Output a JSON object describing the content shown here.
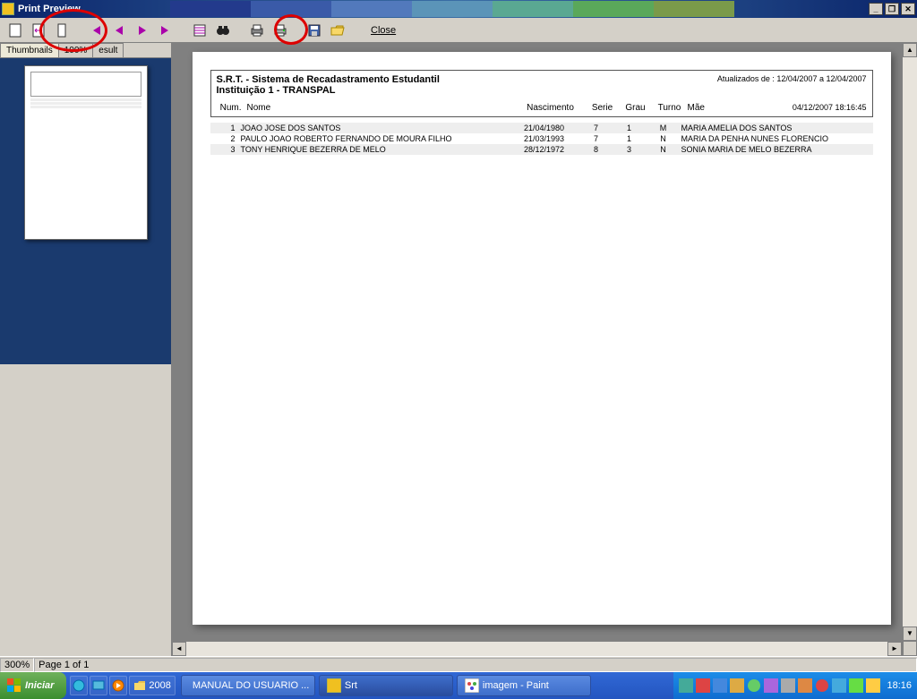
{
  "window": {
    "title": "Print Preview",
    "minimize": "_",
    "maximize": "❐",
    "close": "✕"
  },
  "toolbar": {
    "close_label": "Close"
  },
  "tabs": {
    "thumbnails": "Thumbnails",
    "search": "100%",
    "result": "esult"
  },
  "report": {
    "title": "S.R.T. - Sistema de Recadastramento Estudantil",
    "subtitle": "Instituição  1 - TRANSPAL",
    "updated_label": "Atualizados de : 12/04/2007 a 12/04/2007",
    "datetime": "04/12/2007 18:16:45",
    "headers": {
      "num": "Num.",
      "nome": "Nome",
      "nasc": "Nascimento",
      "serie": "Serie",
      "grau": "Grau",
      "turno": "Turno",
      "mae": "Mãe"
    },
    "rows": [
      {
        "num": "1",
        "nome": "JOAO JOSE DOS SANTOS",
        "nasc": "21/04/1980",
        "serie": "7",
        "grau": "1",
        "turno": "M",
        "mae": "MARIA AMELIA DOS SANTOS"
      },
      {
        "num": "2",
        "nome": "PAULO JOAO ROBERTO FERNANDO DE MOURA FILHO",
        "nasc": "21/03/1993",
        "serie": "7",
        "grau": "1",
        "turno": "N",
        "mae": "MARIA DA PENHA NUNES FLORENCIO"
      },
      {
        "num": "3",
        "nome": "TONY HENRIQUE BEZERRA DE MELO",
        "nasc": "28/12/1972",
        "serie": "8",
        "grau": "3",
        "turno": "N",
        "mae": "SONIA MARIA DE MELO BEZERRA"
      }
    ]
  },
  "status": {
    "zoom": "300%",
    "page": "Page 1 of 1"
  },
  "taskbar": {
    "start": "Iniciar",
    "ql_folder": "2008",
    "items": [
      {
        "icon": "word",
        "label": "MANUAL DO USUARIO ..."
      },
      {
        "icon": "app",
        "label": "Srt"
      },
      {
        "icon": "paint",
        "label": "imagem - Paint"
      }
    ],
    "clock": "18:16"
  }
}
